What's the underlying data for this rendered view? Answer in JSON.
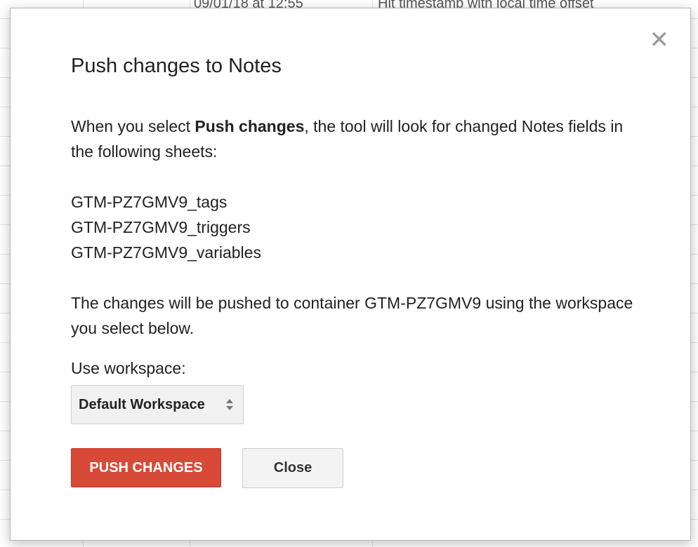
{
  "background_sheet": {
    "cell_date": "09/01/18 at 12:55",
    "cell_description": "Hit timestamp with local time offset"
  },
  "dialog": {
    "title": "Push changes to Notes",
    "intro_before": "When you select ",
    "intro_bold": "Push changes",
    "intro_after": ", the tool will look for changed Notes fields in the following sheets:",
    "sheets": [
      "GTM-PZ7GMV9_tags",
      "GTM-PZ7GMV9_triggers",
      "GTM-PZ7GMV9_variables"
    ],
    "outro": "The changes will be pushed to container GTM-PZ7GMV9 using the workspace you select below.",
    "workspace_label": "Use workspace:",
    "workspace_selected": "Default Workspace",
    "push_button": "PUSH CHANGES",
    "close_button": "Close",
    "close_icon": "close-icon"
  },
  "colors": {
    "push_button_bg": "#d84a38",
    "close_button_bg": "#f3f3f3"
  }
}
